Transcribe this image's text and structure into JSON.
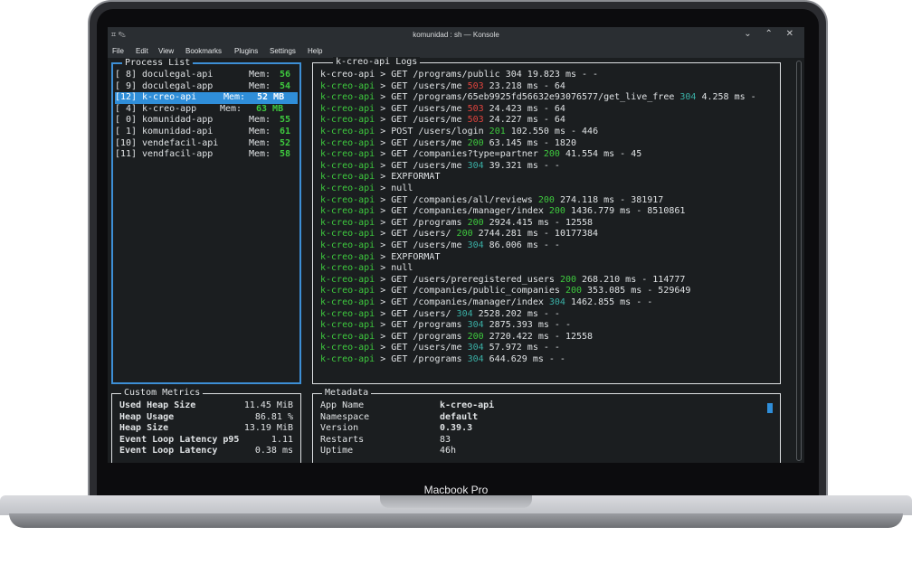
{
  "device_label": "Macbook Pro",
  "window": {
    "title": "komunidad : sh — Konsole",
    "left_icons": "⌗  ✎",
    "controls": "⌄  ⌃  ✕"
  },
  "menu": [
    "File",
    "Edit",
    "View",
    "Bookmarks",
    "Plugins",
    "Settings",
    "Help"
  ],
  "process_list": {
    "title": "Process List",
    "items": [
      {
        "id": "[ 8]",
        "name": "doculegal-api",
        "mem_label": "Mem:",
        "mem": "56"
      },
      {
        "id": "[ 9]",
        "name": "doculegal-app",
        "mem_label": "Mem:",
        "mem": "54"
      },
      {
        "id": "[12]",
        "name": "k-creo-api",
        "mem_label": "Mem:",
        "mem": "52 MB"
      },
      {
        "id": "[ 4]",
        "name": "k-creo-app",
        "mem_label": "Mem:",
        "mem": "63 MB"
      },
      {
        "id": "[ 0]",
        "name": "komunidad-app",
        "mem_label": "Mem:",
        "mem": "55"
      },
      {
        "id": "[ 1]",
        "name": "komunidad-api",
        "mem_label": "Mem:",
        "mem": "61"
      },
      {
        "id": "[10]",
        "name": "vendefacil-api",
        "mem_label": "Mem:",
        "mem": "52"
      },
      {
        "id": "[11]",
        "name": "vendfacil-app",
        "mem_label": "Mem:",
        "mem": "58"
      }
    ]
  },
  "logs": {
    "title": "k-creo-api Logs",
    "prefix": "k-creo-api",
    "lines": [
      {
        "a": "> GET /programs/public 304 19.823 ms - -",
        "s": "",
        "b": ""
      },
      {
        "a": "> GET /users/me ",
        "s": "503",
        "b": " 23.218 ms - 64"
      },
      {
        "a": "> GET /programs/65eb9925fd56632e93076577/get_live_free ",
        "s": "304",
        "b": " 4.258 ms -"
      },
      {
        "a": "> GET /users/me ",
        "s": "503",
        "b": " 24.423 ms - 64"
      },
      {
        "a": "> GET /users/me ",
        "s": "503",
        "b": " 24.227 ms - 64"
      },
      {
        "a": "> POST /users/login ",
        "s": "201",
        "b": " 102.550 ms - 446"
      },
      {
        "a": "> GET /users/me ",
        "s": "200",
        "b": " 63.145 ms - 1820"
      },
      {
        "a": "> GET /companies?type=partner ",
        "s": "200",
        "b": " 41.554 ms - 45"
      },
      {
        "a": "> GET /users/me ",
        "s": "304",
        "b": " 39.321 ms - -"
      },
      {
        "a": "> EXPFORMAT",
        "s": "",
        "b": ""
      },
      {
        "a": "> null",
        "s": "",
        "b": ""
      },
      {
        "a": "> GET /companies/all/reviews ",
        "s": "200",
        "b": " 274.118 ms - 381917"
      },
      {
        "a": "> GET /companies/manager/index ",
        "s": "200",
        "b": " 1436.779 ms - 8510861"
      },
      {
        "a": "> GET /programs ",
        "s": "200",
        "b": " 2924.415 ms - 12558"
      },
      {
        "a": "> GET /users/ ",
        "s": "200",
        "b": " 2744.281 ms - 10177384"
      },
      {
        "a": "> GET /users/me ",
        "s": "304",
        "b": " 86.006 ms - -"
      },
      {
        "a": "> EXPFORMAT",
        "s": "",
        "b": ""
      },
      {
        "a": "> null",
        "s": "",
        "b": ""
      },
      {
        "a": "> GET /users/preregistered_users ",
        "s": "200",
        "b": " 268.210 ms - 114777"
      },
      {
        "a": "> GET /companies/public_companies ",
        "s": "200",
        "b": " 353.085 ms - 529649"
      },
      {
        "a": "> GET /companies/manager/index ",
        "s": "304",
        "b": " 1462.855 ms - -"
      },
      {
        "a": "> GET /users/ ",
        "s": "304",
        "b": " 2528.202 ms - -"
      },
      {
        "a": "> GET /programs ",
        "s": "304",
        "b": " 2875.393 ms - -"
      },
      {
        "a": "> GET /programs ",
        "s": "200",
        "b": " 2720.422 ms - 12558"
      },
      {
        "a": "> GET /users/me ",
        "s": "304",
        "b": " 57.972 ms - -"
      },
      {
        "a": "> GET /programs ",
        "s": "304",
        "b": " 644.629 ms - -"
      }
    ]
  },
  "metrics": {
    "title": "Custom Metrics",
    "items": [
      {
        "label": "Used Heap Size",
        "value": "11.45 MiB"
      },
      {
        "label": "Heap Usage",
        "value": "86.81 %"
      },
      {
        "label": "Heap Size",
        "value": "13.19 MiB"
      },
      {
        "label": "Event Loop Latency p95",
        "value": "1.11"
      },
      {
        "label": "Event Loop Latency",
        "value": "0.38 ms"
      }
    ]
  },
  "metadata": {
    "title": "Metadata",
    "items": [
      {
        "label": "App Name",
        "value": "k-creo-api"
      },
      {
        "label": "Namespace",
        "value": "default"
      },
      {
        "label": "Version",
        "value": "0.39.3"
      },
      {
        "label": "Restarts",
        "value": "83"
      },
      {
        "label": "Uptime",
        "value": "46h"
      }
    ]
  },
  "colors": {
    "status_ok": "#3ec93e",
    "status_error": "#e0443e",
    "status_cached": "#3ab0a6",
    "focus": "#2f8ed9"
  }
}
